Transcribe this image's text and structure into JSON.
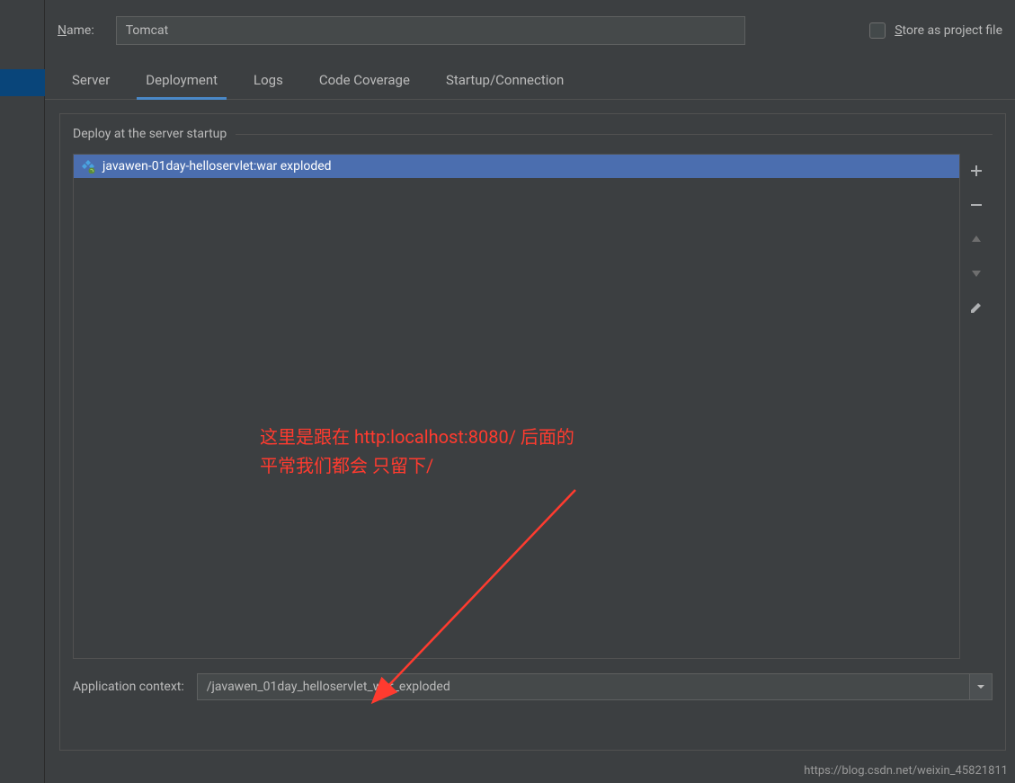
{
  "header": {
    "name_label": "ame:",
    "name_value": "Tomcat",
    "store_label": "tore as project file"
  },
  "tabs": [
    {
      "label": "Server"
    },
    {
      "label": "Deployment"
    },
    {
      "label": "Logs"
    },
    {
      "label": "Code Coverage"
    },
    {
      "label": "Startup/Connection"
    }
  ],
  "deploy": {
    "section_label": "Deploy at the server startup",
    "item_label": "javawen-01day-helloservlet:war exploded",
    "context_label": "Application context:",
    "context_value": "/javawen_01day_helloservlet_war_exploded"
  },
  "annotation": {
    "line1": "这里是跟在 http:localhost:8080/  后面的",
    "line2": "平常我们都会 只留下/"
  },
  "watermark": "https://blog.csdn.net/weixin_45821811"
}
